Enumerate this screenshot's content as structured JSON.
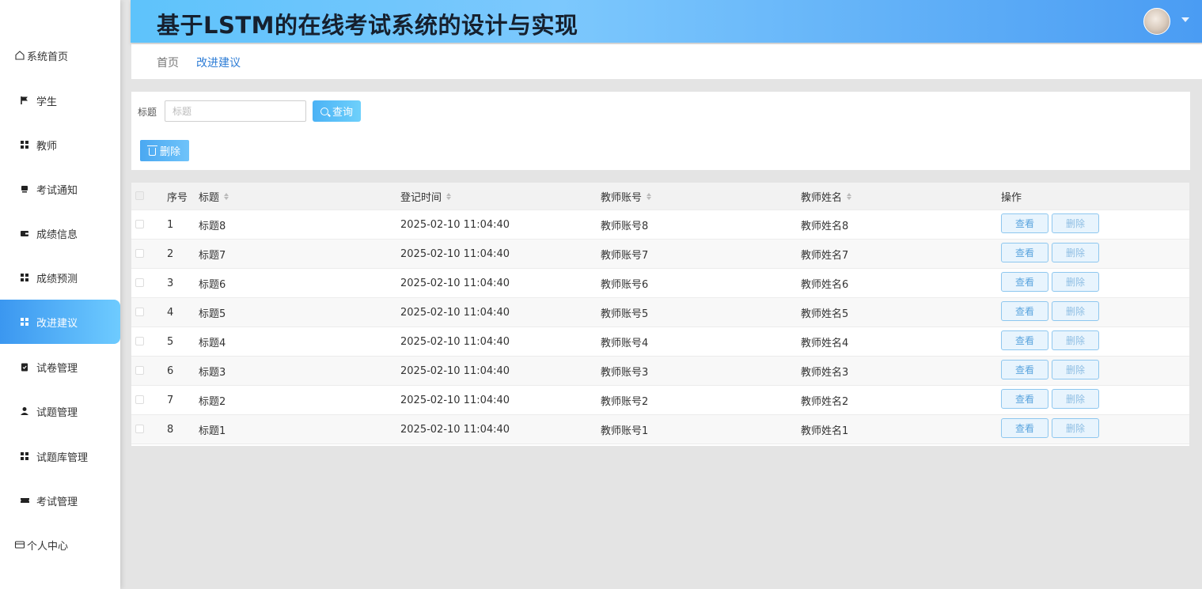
{
  "header": {
    "title": "基于LSTM的在线考试系统的设计与实现"
  },
  "sidebar": {
    "items": [
      {
        "label": "系统首页",
        "icon": "home-icon",
        "name": "sidebar-item-home"
      },
      {
        "label": "学生",
        "icon": "flag-icon",
        "name": "sidebar-item-student"
      },
      {
        "label": "教师",
        "icon": "grid-icon",
        "name": "sidebar-item-teacher"
      },
      {
        "label": "考试通知",
        "icon": "notice-icon",
        "name": "sidebar-item-exam-notice"
      },
      {
        "label": "成绩信息",
        "icon": "wallet-icon",
        "name": "sidebar-item-score-info"
      },
      {
        "label": "成绩预测",
        "icon": "grid-icon",
        "name": "sidebar-item-score-predict"
      },
      {
        "label": "改进建议",
        "icon": "grid-icon",
        "name": "sidebar-item-suggestion"
      },
      {
        "label": "试卷管理",
        "icon": "clipboard-icon",
        "name": "sidebar-item-paper-manage"
      },
      {
        "label": "试题管理",
        "icon": "user-icon",
        "name": "sidebar-item-question-manage"
      },
      {
        "label": "试题库管理",
        "icon": "grid-icon",
        "name": "sidebar-item-bank-manage"
      },
      {
        "label": "考试管理",
        "icon": "ticket-icon",
        "name": "sidebar-item-exam-manage"
      },
      {
        "label": "个人中心",
        "icon": "card-icon",
        "name": "sidebar-item-profile"
      }
    ]
  },
  "breadcrumb": {
    "home": "首页",
    "current": "改进建议"
  },
  "search": {
    "label": "标题",
    "placeholder": "标题",
    "query_button": "查询",
    "delete_button": "删除"
  },
  "table": {
    "columns": {
      "index": "序号",
      "title": "标题",
      "time": "登记时间",
      "account": "教师账号",
      "name": "教师姓名",
      "actions": "操作"
    },
    "view_label": "查看",
    "delete_label": "删除",
    "rows": [
      {
        "index": "1",
        "title": "标题8",
        "time": "2025-02-10 11:04:40",
        "account": "教师账号8",
        "name": "教师姓名8"
      },
      {
        "index": "2",
        "title": "标题7",
        "time": "2025-02-10 11:04:40",
        "account": "教师账号7",
        "name": "教师姓名7"
      },
      {
        "index": "3",
        "title": "标题6",
        "time": "2025-02-10 11:04:40",
        "account": "教师账号6",
        "name": "教师姓名6"
      },
      {
        "index": "4",
        "title": "标题5",
        "time": "2025-02-10 11:04:40",
        "account": "教师账号5",
        "name": "教师姓名5"
      },
      {
        "index": "5",
        "title": "标题4",
        "time": "2025-02-10 11:04:40",
        "account": "教师账号4",
        "name": "教师姓名4"
      },
      {
        "index": "6",
        "title": "标题3",
        "time": "2025-02-10 11:04:40",
        "account": "教师账号3",
        "name": "教师姓名3"
      },
      {
        "index": "7",
        "title": "标题2",
        "time": "2025-02-10 11:04:40",
        "account": "教师账号2",
        "name": "教师姓名2"
      },
      {
        "index": "8",
        "title": "标题1",
        "time": "2025-02-10 11:04:40",
        "account": "教师账号1",
        "name": "教师姓名1"
      }
    ]
  },
  "colors": {
    "accent": "#3b97f0",
    "header_start": "#5ec3fb",
    "header_end": "#4a9cf3"
  }
}
